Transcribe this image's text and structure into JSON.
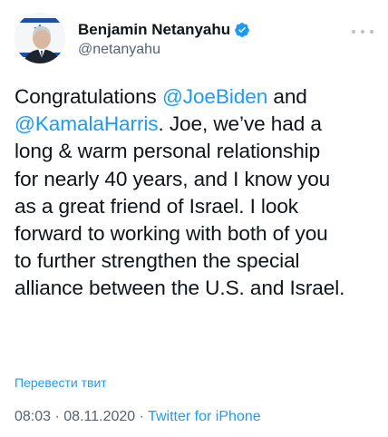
{
  "author": {
    "display_name": "Benjamin Netanyahu",
    "handle": "@netanyahu",
    "verified": true,
    "avatar_icon": "profile-photo-with-flag"
  },
  "tweet": {
    "lines": [
      {
        "segments": [
          {
            "text": "Congratulations ",
            "type": "text"
          },
          {
            "text": "@JoeBiden",
            "type": "mention"
          },
          {
            "text": " and",
            "type": "text"
          }
        ]
      },
      {
        "segments": [
          {
            "text": "@KamalaHarris",
            "type": "mention"
          },
          {
            "text": ". Joe, we’ve had a",
            "type": "text"
          }
        ]
      },
      {
        "segments": [
          {
            "text": "long & warm personal relationship",
            "type": "text"
          }
        ]
      },
      {
        "segments": [
          {
            "text": "for nearly 40 years, and I know you",
            "type": "text"
          }
        ]
      },
      {
        "segments": [
          {
            "text": "as a great friend of Israel. I look",
            "type": "text"
          }
        ]
      },
      {
        "segments": [
          {
            "text": "forward to working with both of you",
            "type": "text"
          }
        ]
      },
      {
        "segments": [
          {
            "text": "to further strengthen the special",
            "type": "text"
          }
        ]
      },
      {
        "segments": [
          {
            "text": "alliance between the U.S. and Israel.",
            "type": "text"
          }
        ]
      }
    ]
  },
  "translate_label": "Перевести твит",
  "meta": {
    "time": "08:03",
    "separator": "·",
    "date": "08.11.2020",
    "source": "Twitter for iPhone"
  },
  "colors": {
    "accent": "#1d9bf0",
    "text": "#0f1419",
    "secondary": "#536471"
  },
  "icons": {
    "verified": "verified-badge-icon",
    "more": "more-options-icon"
  }
}
